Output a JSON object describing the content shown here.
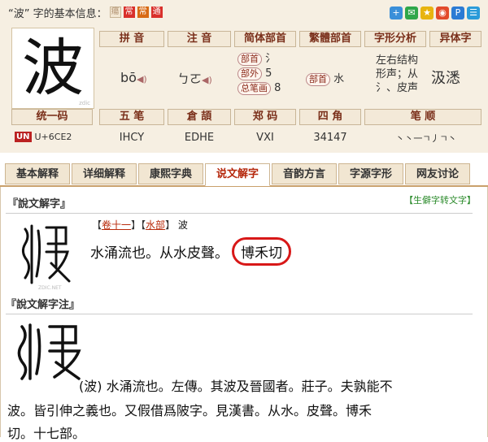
{
  "title": {
    "prefix": "“波” 字的基本信息：",
    "tags": [
      "瘍",
      "常",
      "常",
      "通"
    ]
  },
  "share_icons": [
    "plus-share-icon",
    "wechat-share-icon",
    "qzone-share-icon",
    "weibo-share-icon",
    "pengyou-share-icon",
    "tencent-weibo-share-icon"
  ],
  "character": "波",
  "headers": {
    "pinyin": "拼 音",
    "zhuyin": "注 音",
    "simplified_radical": "简体部首",
    "traditional_radical": "繁體部首",
    "structure": "字形分析",
    "variant": "异体字"
  },
  "pinyin_value": "bō",
  "zhuyin_value": "ㄅㄛ",
  "radical_info": {
    "bushou_label": "部首",
    "bushou": "氵",
    "buwai_label": "部外",
    "buwai": "5",
    "zongbihua_label": "总笔画",
    "zongbihua": "8"
  },
  "trad_radical": {
    "label": "部首",
    "value": "水"
  },
  "structure_text": "左右结构\n形声；从\n氵、皮声",
  "variant_text": "汲㴽",
  "codes_headers": [
    "统一码",
    "五 笔",
    "倉 頡",
    "郑 码",
    "四 角",
    "笔 顺"
  ],
  "codes_values": [
    "U+6CE2",
    "IHCY",
    "EDHE",
    "VXI",
    "34147",
    "丶丶一ㄱ丿ㄱ丶"
  ],
  "unicode_logo": "UN",
  "tabs": [
    "基本解释",
    "详细解释",
    "康熙字典",
    "说文解字",
    "音韵方言",
    "字源字形",
    "网友讨论"
  ],
  "active_tab": "说文解字",
  "shuowen": {
    "title": "『說文解字』",
    "convert_link": "【生僻字转文字】",
    "juan": "卷十一",
    "bu": "水部",
    "char": "波",
    "definition_main": "水涌流也。从水皮聲。",
    "definition_circled": "博禾切",
    "seal_watermark": "ZDIC.NET"
  },
  "shuowen_zhu": {
    "title": "『說文解字注』",
    "line1": "(波) 水涌流也。左傳。其波及晉國者。莊子。夫孰能不",
    "line2": "波。皆引伸之義也。又假借爲陂字。見漢書。从水。皮聲。博禾",
    "line3": "切。十七部。"
  }
}
